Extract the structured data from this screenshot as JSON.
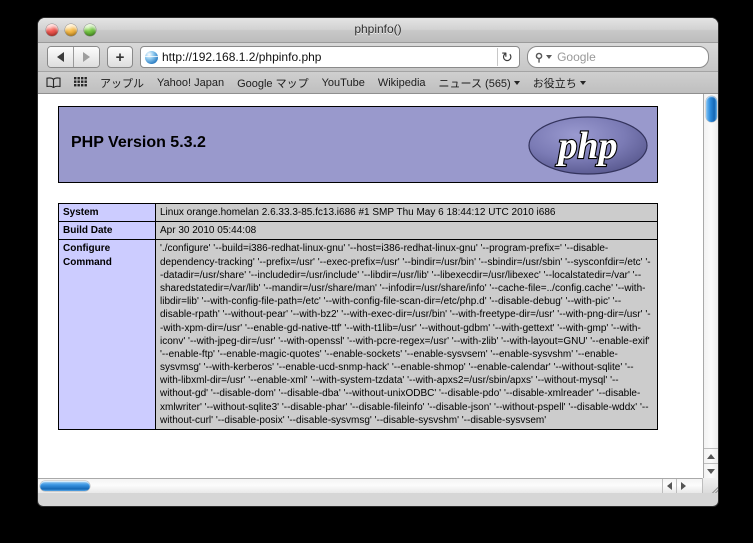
{
  "window": {
    "title": "phpinfo()",
    "controls": {
      "close": "close-button",
      "minimize": "minimize-button",
      "zoom": "zoom-button"
    }
  },
  "toolbar": {
    "back_label": "◀",
    "forward_label": "▶",
    "add_tab_label": "+",
    "url": "http://192.168.1.2/phpinfo.php",
    "reload_label": "↻",
    "search_placeholder": "Google"
  },
  "bookmarks": {
    "icons": [
      "book-icon",
      "grid-icon"
    ],
    "items": [
      {
        "label": "アップル",
        "has_caret": false
      },
      {
        "label": "Yahoo! Japan",
        "has_caret": false
      },
      {
        "label": "Google マップ",
        "has_caret": false
      },
      {
        "label": "YouTube",
        "has_caret": false
      },
      {
        "label": "Wikipedia",
        "has_caret": false
      },
      {
        "label": "ニュース (565)",
        "has_caret": true
      },
      {
        "label": "お役立ち",
        "has_caret": true
      }
    ]
  },
  "page": {
    "php_version": "PHP Version 5.3.2",
    "logo_text": "php",
    "header_bg": "#9999cc",
    "key_bg": "#ccccff",
    "value_bg": "#cccccc",
    "rows": [
      {
        "key": "System",
        "value": "Linux orange.homelan 2.6.33.3-85.fc13.i686 #1 SMP Thu May 6 18:44:12 UTC 2010 i686"
      },
      {
        "key": "Build Date",
        "value": "Apr 30 2010 05:44:08"
      },
      {
        "key": "Configure Command",
        "value": "'./configure' '--build=i386-redhat-linux-gnu' '--host=i386-redhat-linux-gnu' '--program-prefix=' '--disable-dependency-tracking' '--prefix=/usr' '--exec-prefix=/usr' '--bindir=/usr/bin' '--sbindir=/usr/sbin' '--sysconfdir=/etc' '--datadir=/usr/share' '--includedir=/usr/include' '--libdir=/usr/lib' '--libexecdir=/usr/libexec' '--localstatedir=/var' '--sharedstatedir=/var/lib' '--mandir=/usr/share/man' '--infodir=/usr/share/info' '--cache-file=../config.cache' '--with-libdir=lib' '--with-config-file-path=/etc' '--with-config-file-scan-dir=/etc/php.d' '--disable-debug' '--with-pic' '--disable-rpath' '--without-pear' '--with-bz2' '--with-exec-dir=/usr/bin' '--with-freetype-dir=/usr' '--with-png-dir=/usr' '--with-xpm-dir=/usr' '--enable-gd-native-ttf' '--with-t1lib=/usr' '--without-gdbm' '--with-gettext' '--with-gmp' '--with-iconv' '--with-jpeg-dir=/usr' '--with-openssl' '--with-pcre-regex=/usr' '--with-zlib' '--with-layout=GNU' '--enable-exif' '--enable-ftp' '--enable-magic-quotes' '--enable-sockets' '--enable-sysvsem' '--enable-sysvshm' '--enable-sysvmsg' '--with-kerberos' '--enable-ucd-snmp-hack' '--enable-shmop' '--enable-calendar' '--without-sqlite' '--with-libxml-dir=/usr' '--enable-xml' '--with-system-tzdata' '--with-apxs2=/usr/sbin/apxs' '--without-mysql' '--without-gd' '--disable-dom' '--disable-dba' '--without-unixODBC' '--disable-pdo' '--disable-xmlreader' '--disable-xmlwriter' '--without-sqlite3' '--disable-phar' '--disable-fileinfo' '--disable-json' '--without-pspell' '--disable-wddx' '--without-curl' '--disable-posix' '--disable-sysvmsg' '--disable-sysvshm' '--disable-sysvsem'"
      }
    ]
  },
  "scrollbars": {
    "vertical_thumb_position": "top",
    "horizontal_thumb_position": "left"
  }
}
